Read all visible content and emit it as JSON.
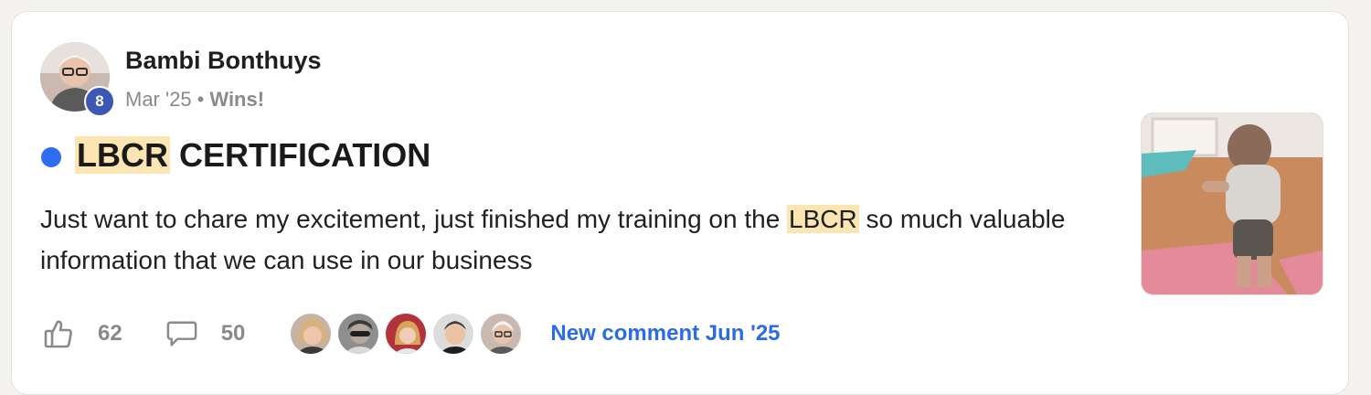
{
  "post": {
    "author": "Bambi Bonthuys",
    "level": "8",
    "date": "Mar '25",
    "separator": "•",
    "category": "Wins!",
    "title_highlight": "LBCR",
    "title_rest": "CERTIFICATION",
    "body_before": "Just want to chare my excitement, just finished my training on the",
    "body_highlight": "LBCR",
    "body_after": "so much valuable information that we can use in our business",
    "likes": "62",
    "comments": "50",
    "new_comment": "New comment Jun '25"
  },
  "icons": {
    "like": "thumbs-up-icon",
    "comment": "speech-bubble-icon"
  },
  "colors": {
    "unread_dot": "#2f6df0",
    "level_badge": "#3d57b5",
    "highlight": "#fbe5b2",
    "link": "#2b6be4",
    "muted": "#8a8a8a"
  }
}
